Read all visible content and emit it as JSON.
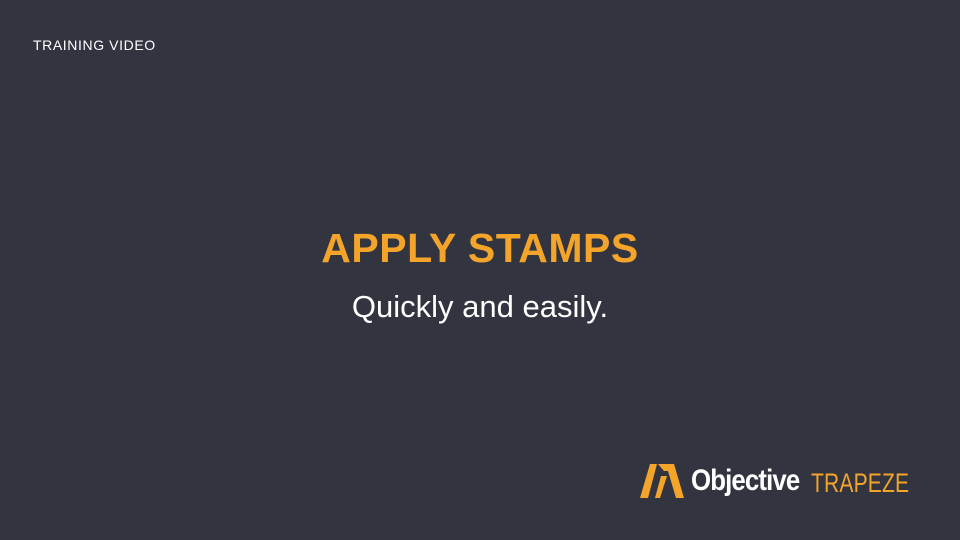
{
  "slide": {
    "eyebrow": "TRAINING VIDEO",
    "headline": "APPLY STAMPS",
    "subheadline": "Quickly and easily."
  },
  "brand": {
    "logo_icon": "objective-mark-icon",
    "name": "Objective",
    "product": "TRAPEZE"
  },
  "colors": {
    "background": "#323440",
    "accent": "#f5a42a",
    "text": "#ffffff"
  }
}
